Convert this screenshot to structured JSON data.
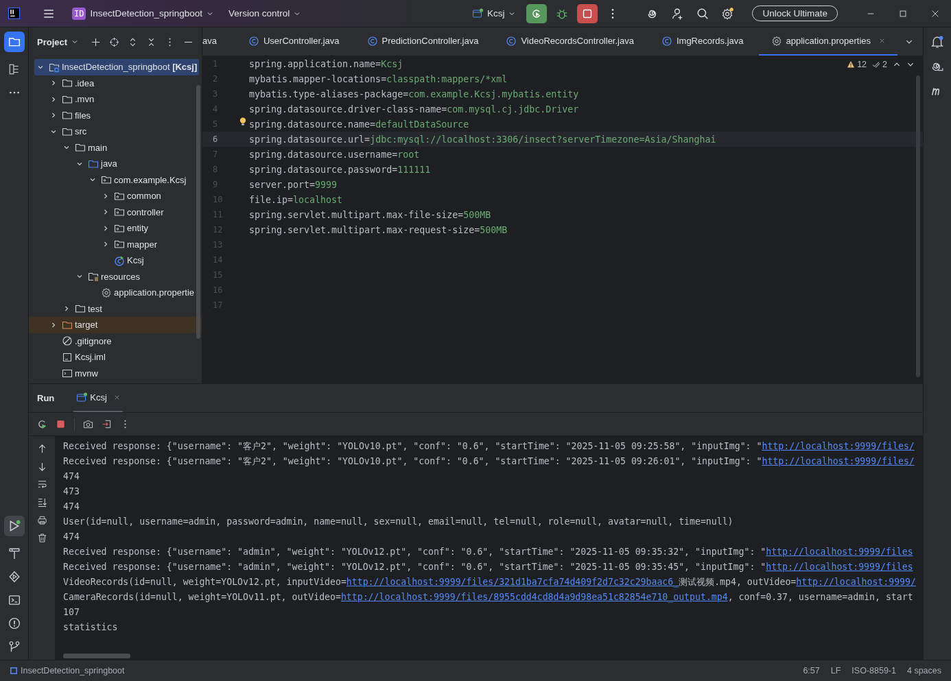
{
  "title_bar": {
    "project_badge": "ID",
    "project": "InsectDetection_springboot",
    "vcs": "Version control",
    "run_config": "Kcsj",
    "upgrade_button": "Unlock Ultimate"
  },
  "project_panel": {
    "title": "Project",
    "tree": [
      {
        "label": "InsectDetection_springboot **[Kcsj]**",
        "kind": "module",
        "selected": true,
        "expanded": true,
        "children": [
          {
            "label": ".idea",
            "kind": "folder",
            "selected": false,
            "expanded": false
          },
          {
            "label": ".mvn",
            "kind": "folder",
            "selected": false,
            "expanded": false
          },
          {
            "label": "files",
            "kind": "folder",
            "selected": false,
            "expanded": false
          },
          {
            "label": "src",
            "kind": "folder",
            "selected": false,
            "expanded": true,
            "children": [
              {
                "label": "main",
                "kind": "folder",
                "selected": false,
                "expanded": true,
                "children": [
                  {
                    "label": "java",
                    "kind": "source",
                    "selected": false,
                    "expanded": true,
                    "children": [
                      {
                        "label": "com.example.Kcsj",
                        "kind": "package",
                        "selected": false,
                        "expanded": true,
                        "children": [
                          {
                            "label": "common",
                            "kind": "package",
                            "selected": false,
                            "expanded": false
                          },
                          {
                            "label": "controller",
                            "kind": "package",
                            "selected": false,
                            "expanded": false
                          },
                          {
                            "label": "entity",
                            "kind": "package",
                            "selected": false,
                            "expanded": false
                          },
                          {
                            "label": "mapper",
                            "kind": "package",
                            "selected": false,
                            "expanded": false
                          },
                          {
                            "label": "Kcsj",
                            "kind": "app",
                            "selected": false
                          }
                        ]
                      }
                    ]
                  },
                  {
                    "label": "resources",
                    "kind": "resources",
                    "selected": false,
                    "expanded": true,
                    "children": [
                      {
                        "label": "application.propertie",
                        "kind": "settings",
                        "selected": false
                      }
                    ]
                  }
                ]
              },
              {
                "label": "test",
                "kind": "folder",
                "selected": false,
                "expanded": false
              }
            ]
          },
          {
            "label": "target",
            "kind": "excluded",
            "selected": false,
            "expanded": false
          },
          {
            "label": ".gitignore",
            "kind": "ignore",
            "selected": false
          },
          {
            "label": "Kcsj.iml",
            "kind": "file",
            "selected": false
          },
          {
            "label": "mvnw",
            "kind": "script",
            "selected": false
          }
        ]
      }
    ]
  },
  "editor": {
    "tabs": [
      {
        "label": "ava",
        "kind": "plain",
        "selected": false
      },
      {
        "label": "UserController.java",
        "kind": "class",
        "selected": false
      },
      {
        "label": "PredictionController.java",
        "kind": "class",
        "selected": false
      },
      {
        "label": "VideoRecordsController.java",
        "kind": "class",
        "selected": false
      },
      {
        "label": "ImgRecords.java",
        "kind": "class",
        "selected": false
      },
      {
        "label": "application.properties",
        "kind": "settings",
        "selected": true
      }
    ],
    "warnings": "12",
    "weak_warnings": "2",
    "lines": [
      {
        "number": "1",
        "key": "spring.application.name=",
        "value": "Kcsj",
        "current": false
      },
      {
        "number": "2",
        "key": "mybatis.mapper-locations=",
        "value": "classpath:mappers/*xml",
        "current": false
      },
      {
        "number": "3",
        "key": "mybatis.type-aliases-package=",
        "value": "com.example.Kcsj.mybatis.entity",
        "current": false
      },
      {
        "number": "4",
        "key": "spring.datasource.driver-class-name=",
        "value": "com.mysql.cj.jdbc.Driver",
        "current": false
      },
      {
        "number": "5",
        "key": "spring.datasource.name=",
        "value": "defaultDataSource",
        "current": false
      },
      {
        "number": "6",
        "key": "spring.datasource.url=",
        "value": "jdbc:mysql://localhost:3306/insect?serverTimezone=Asia/Shanghai",
        "current": true
      },
      {
        "number": "7",
        "key": "spring.datasource.username=",
        "value": "root",
        "current": false
      },
      {
        "number": "8",
        "key": "spring.datasource.password=",
        "value": "111111",
        "current": false
      },
      {
        "number": "9",
        "key": "server.port=",
        "value": "9999",
        "current": false
      },
      {
        "number": "10",
        "key": "file.ip=",
        "value": "localhost",
        "current": false
      },
      {
        "number": "11",
        "key": "spring.servlet.multipart.max-file-size=",
        "value": "500MB",
        "current": false
      },
      {
        "number": "12",
        "key": "spring.servlet.multipart.max-request-size=",
        "value": "500MB",
        "current": false
      },
      {
        "number": "13",
        "current": false
      },
      {
        "number": "14",
        "current": false
      },
      {
        "number": "15",
        "current": false
      },
      {
        "number": "16",
        "current": false
      },
      {
        "number": "17",
        "current": false
      }
    ]
  },
  "run_panel": {
    "title": "Run",
    "tabs": [
      {
        "label": "Kcsj",
        "selected": true
      }
    ],
    "console": [
      [
        {
          "kind": "text",
          "text": "Received response: {\"username\": \"客户2\", \"weight\": \"YOLOv10.pt\", \"conf\": \"0.6\", \"startTime\": \"2025-11-05 09:25:58\", \"inputImg\": \""
        },
        {
          "kind": "link",
          "text": "http://localhost:9999/files/"
        }
      ],
      [
        {
          "kind": "text",
          "text": "Received response: {\"username\": \"客户2\", \"weight\": \"YOLOv10.pt\", \"conf\": \"0.6\", \"startTime\": \"2025-11-05 09:26:01\", \"inputImg\": \""
        },
        {
          "kind": "link",
          "text": "http://localhost:9999/files/"
        }
      ],
      [
        {
          "kind": "text",
          "text": "474"
        }
      ],
      [
        {
          "kind": "text",
          "text": "473"
        }
      ],
      [
        {
          "kind": "text",
          "text": "474"
        }
      ],
      [
        {
          "kind": "text",
          "text": "User(id=null, username=admin, password=admin, name=null, sex=null, email=null, tel=null, role=null, avatar=null, time=null)"
        }
      ],
      [
        {
          "kind": "text",
          "text": "474"
        }
      ],
      [
        {
          "kind": "text",
          "text": "Received response: {\"username\": \"admin\", \"weight\": \"YOLOv12.pt\", \"conf\": \"0.6\", \"startTime\": \"2025-11-05 09:35:32\", \"inputImg\": \""
        },
        {
          "kind": "link",
          "text": "http://localhost:9999/files"
        }
      ],
      [
        {
          "kind": "text",
          "text": "Received response: {\"username\": \"admin\", \"weight\": \"YOLOv12.pt\", \"conf\": \"0.6\", \"startTime\": \"2025-11-05 09:35:45\", \"inputImg\": \""
        },
        {
          "kind": "link",
          "text": "http://localhost:9999/files"
        }
      ],
      [
        {
          "kind": "text",
          "text": "VideoRecords(id=null, weight=YOLOv12.pt, inputVideo="
        },
        {
          "kind": "link",
          "text": "http://localhost:9999/files/321d1ba7cfa74d409f2d7c32c29baac6_"
        },
        {
          "kind": "text",
          "text": "测试视频.mp4, outVideo="
        },
        {
          "kind": "link",
          "text": "http://localhost:9999/"
        }
      ],
      [
        {
          "kind": "text",
          "text": "CameraRecords(id=null, weight=YOLOv11.pt, outVideo="
        },
        {
          "kind": "link",
          "text": "http://localhost:9999/files/8955cdd4cd8d4a9d98ea51c82854e710_output.mp4"
        },
        {
          "kind": "text",
          "text": ", conf=0.37, username=admin, start"
        }
      ],
      [
        {
          "kind": "text",
          "text": "107"
        }
      ],
      [
        {
          "kind": "text",
          "text": "statistics"
        }
      ]
    ]
  },
  "status_bar": {
    "breadcrumb": "InsectDetection_springboot",
    "position": "6:57",
    "line_separator": "LF",
    "encoding": "ISO-8859-1",
    "indent": "4 spaces"
  }
}
